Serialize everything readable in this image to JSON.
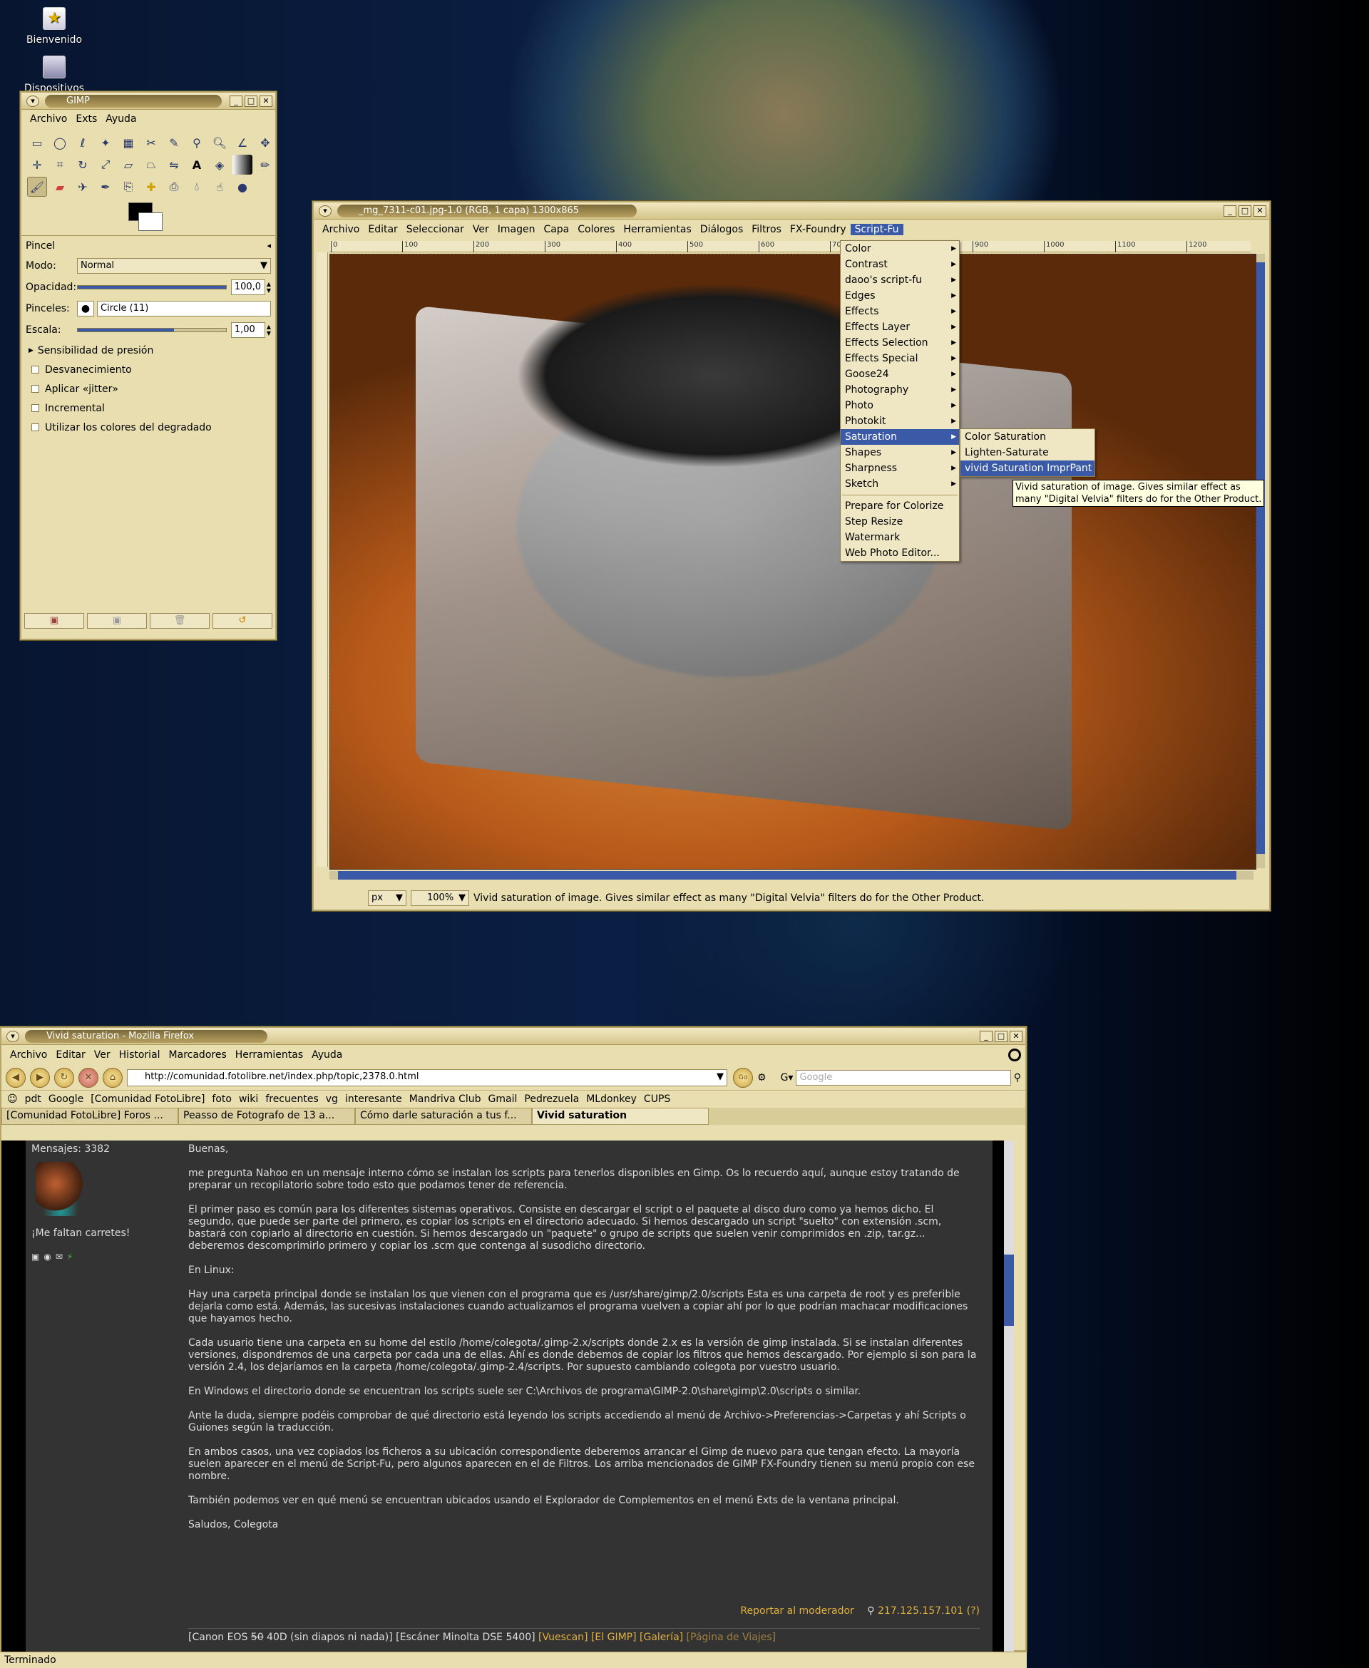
{
  "desktop": {
    "icons": [
      {
        "label": "Bienvenido",
        "icon": "star-icon"
      },
      {
        "label": "Dispositivos",
        "icon": "computer-icon"
      }
    ]
  },
  "gimp_toolbox": {
    "title": "GIMP",
    "menu": [
      "Archivo",
      "Exts",
      "Ayuda"
    ],
    "tools": [
      "rect-select",
      "ellipse-select",
      "lasso",
      "fuzzy-select",
      "color-select",
      "scissors",
      "paths",
      "color-picker",
      "zoom",
      "measure",
      "move",
      "align",
      "crop",
      "rotate",
      "scale",
      "shear",
      "perspective",
      "flip",
      "text",
      "bucket-fill",
      "blend",
      "pencil",
      "paintbrush",
      "eraser",
      "airbrush",
      "ink",
      "clone",
      "heal",
      "perspective-clone",
      "blur",
      "smudge",
      "dodge-burn"
    ],
    "options": {
      "section": "Pincel",
      "mode_label": "Modo:",
      "mode_value": "Normal",
      "opacity_label": "Opacidad:",
      "opacity_value": "100,0",
      "opacity_level": 1.0,
      "brushes_label": "Pinceles:",
      "brush_value": "Circle (11)",
      "scale_label": "Escala:",
      "scale_value": "1,00",
      "scale_level": 0.65,
      "pressure": "Sensibilidad de presión",
      "checks": [
        "Desvanecimiento",
        "Aplicar «jitter»",
        "Incremental",
        "Utilizar los colores del degradado"
      ]
    }
  },
  "image_window": {
    "title": "_mg_7311-c01.jpg-1.0 (RGB, 1 capa) 1300x865",
    "menu": [
      "Archivo",
      "Editar",
      "Seleccionar",
      "Ver",
      "Imagen",
      "Capa",
      "Colores",
      "Herramientas",
      "Diálogos",
      "Filtros",
      "FX-Foundry",
      "Script-Fu"
    ],
    "ruler_marks": [
      "0",
      "100",
      "200",
      "300",
      "400",
      "500",
      "600",
      "700",
      "800",
      "900",
      "1000",
      "1100",
      "1200"
    ],
    "unit": "px",
    "zoom": "100%",
    "status": "Vivid saturation of image. Gives similar effect as many \"Digital Velvia\" filters do for the Other Product.",
    "script_fu_menu": [
      {
        "label": "Color",
        "sub": true
      },
      {
        "label": "Contrast",
        "sub": true
      },
      {
        "label": "daoo's script-fu",
        "sub": true
      },
      {
        "label": "Edges",
        "sub": true
      },
      {
        "label": "Effects",
        "sub": true
      },
      {
        "label": "Effects Layer",
        "sub": true
      },
      {
        "label": "Effects Selection",
        "sub": true
      },
      {
        "label": "Effects Special",
        "sub": true
      },
      {
        "label": "Goose24",
        "sub": true
      },
      {
        "label": "Photography",
        "sub": true
      },
      {
        "label": "Photo",
        "sub": true
      },
      {
        "label": "Photokit",
        "sub": true
      },
      {
        "label": "Saturation",
        "sub": true,
        "hl": true
      },
      {
        "label": "Shapes",
        "sub": true
      },
      {
        "label": "Sharpness",
        "sub": true
      },
      {
        "label": "Sketch",
        "sub": true
      },
      {
        "sep": true
      },
      {
        "label": "Prepare for Colorize"
      },
      {
        "label": "Step Resize"
      },
      {
        "label": "Watermark"
      },
      {
        "label": "Web Photo Editor..."
      }
    ],
    "saturation_menu": [
      {
        "label": "Color Saturation"
      },
      {
        "label": "Lighten-Saturate"
      },
      {
        "label": "vivid Saturation    ImprPant",
        "hl": true
      }
    ],
    "tooltip_lines": [
      "Vivid saturation of image. Gives similar effect as",
      "many \"Digital Velvia\" filters do for the Other Product."
    ]
  },
  "firefox": {
    "title": "Vivid saturation - Mozilla Firefox",
    "menu": [
      "Archivo",
      "Editar",
      "Ver",
      "Historial",
      "Marcadores",
      "Herramientas",
      "Ayuda"
    ],
    "url": "http://comunidad.fotolibre.net/index.php/topic,2378.0.html",
    "search_placeholder": "Google",
    "bookmarks": [
      "pdt",
      "Google",
      "[Comunidad FotoLibre]",
      "foto",
      "wiki",
      "frecuentes",
      "vg",
      "interesante",
      "Mandriva Club",
      "Gmail",
      "Pedrezuela",
      "MLdonkey",
      "CUPS"
    ],
    "tabs": [
      {
        "label": "[Comunidad FotoLibre] Foros ..."
      },
      {
        "label": "Peasso de Fotografo de 13 a..."
      },
      {
        "label": "Cómo darle saturación a tus f..."
      },
      {
        "label": "Vivid saturation",
        "active": true
      }
    ],
    "status": "Terminado",
    "sidebar": {
      "messages": "Mensajes: 3382",
      "tagline": "¡Me faltan carretes!"
    },
    "post": [
      "Buenas,",
      "me pregunta Nahoo en un mensaje interno cómo se instalan los scripts para tenerlos disponibles en Gimp. Os lo recuerdo aquí, aunque estoy tratando de preparar un recopilatorio sobre todo esto que podamos tener de referencia.",
      "El primer paso es común para los diferentes sistemas operativos. Consiste en descargar el script o el paquete al disco duro como ya hemos dicho. El segundo, que puede ser parte del primero, es copiar los scripts en el directorio adecuado. Si hemos descargado un script \"suelto\" con extensión .scm, bastará con copiarlo al directorio en cuestión. Si hemos descargado un \"paquete\" o grupo de scripts que suelen venir comprimidos en .zip, tar.gz... deberemos descomprimirlo primero y copiar los .scm que contenga al susodicho directorio.",
      "En Linux:",
      "Hay una carpeta principal donde se instalan los que vienen con el programa que es /usr/share/gimp/2.0/scripts Esta es una carpeta de root y es preferible dejarla como está. Además, las sucesivas instalaciones cuando actualizamos el programa vuelven a copiar ahí por lo que podrían machacar modificaciones que hayamos hecho.",
      "Cada usuario tiene una carpeta en su home del estilo /home/colegota/.gimp-2.x/scripts donde 2.x es la versión de gimp instalada. Si se instalan diferentes versiones, dispondremos de una carpeta por cada una de ellas. Ahí es donde debemos de copiar los filtros que hemos descargado. Por ejemplo si son para la versión 2.4, los dejaríamos en la carpeta /home/colegota/.gimp-2.4/scripts. Por supuesto cambiando colegota por vuestro usuario.",
      "En Windows el directorio donde se encuentran los scripts suele ser C:\\Archivos de programa\\GIMP-2.0\\share\\gimp\\2.0\\scripts o similar.",
      "Ante la duda, siempre podéis comprobar de qué directorio está leyendo los scripts accediendo al menú de Archivo->Preferencias->Carpetas y ahí Scripts o Guiones según la traducción.",
      "En ambos casos, una vez copiados los ficheros a su ubicación correspondiente deberemos arrancar el Gimp de nuevo para que tengan efecto. La mayoría suelen aparecer en el menú de Script-Fu, pero algunos aparecen en el de Filtros. Los arriba mencionados de GIMP FX-Foundry tienen su menú propio con ese nombre.",
      "También podemos ver en qué menú se encuentran ubicados usando el Explorador de Complementos en el menú Exts de la ventana principal.",
      "Saludos, Colegota"
    ],
    "report": "Reportar al moderador",
    "ip": "217.125.157.101 (?)",
    "signature_pre": "[Canon EOS ",
    "signature_strike": "50",
    "signature_mid": " 40D (sin diapos ni nada)] [Escáner Minolta DSE 5400] ",
    "signature_links": [
      "[Vuescan]",
      "[El GIMP]",
      "[Galería]",
      "[Página de Viajes]"
    ]
  }
}
